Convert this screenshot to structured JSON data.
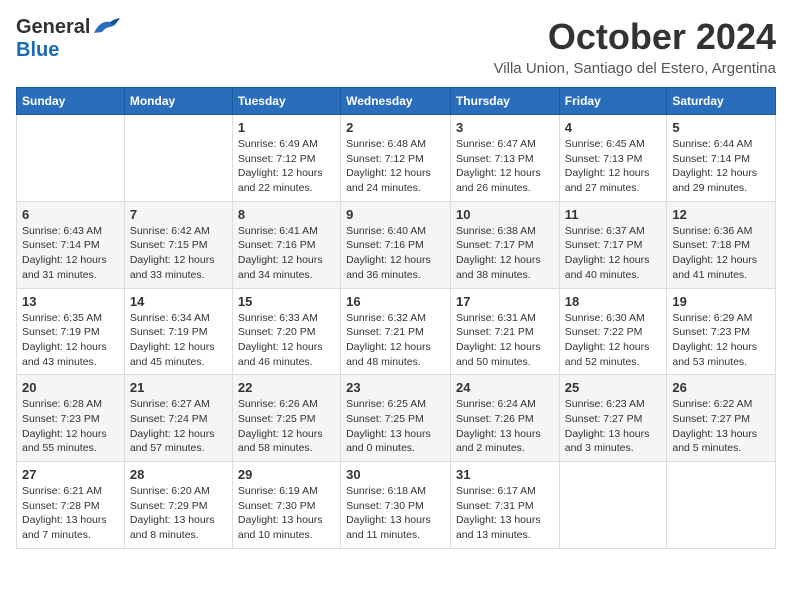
{
  "header": {
    "logo_general": "General",
    "logo_blue": "Blue",
    "month": "October 2024",
    "location": "Villa Union, Santiago del Estero, Argentina"
  },
  "weekdays": [
    "Sunday",
    "Monday",
    "Tuesday",
    "Wednesday",
    "Thursday",
    "Friday",
    "Saturday"
  ],
  "rows": [
    [
      {
        "day": "",
        "info": ""
      },
      {
        "day": "",
        "info": ""
      },
      {
        "day": "1",
        "info": "Sunrise: 6:49 AM\nSunset: 7:12 PM\nDaylight: 12 hours and 22 minutes."
      },
      {
        "day": "2",
        "info": "Sunrise: 6:48 AM\nSunset: 7:12 PM\nDaylight: 12 hours and 24 minutes."
      },
      {
        "day": "3",
        "info": "Sunrise: 6:47 AM\nSunset: 7:13 PM\nDaylight: 12 hours and 26 minutes."
      },
      {
        "day": "4",
        "info": "Sunrise: 6:45 AM\nSunset: 7:13 PM\nDaylight: 12 hours and 27 minutes."
      },
      {
        "day": "5",
        "info": "Sunrise: 6:44 AM\nSunset: 7:14 PM\nDaylight: 12 hours and 29 minutes."
      }
    ],
    [
      {
        "day": "6",
        "info": "Sunrise: 6:43 AM\nSunset: 7:14 PM\nDaylight: 12 hours and 31 minutes."
      },
      {
        "day": "7",
        "info": "Sunrise: 6:42 AM\nSunset: 7:15 PM\nDaylight: 12 hours and 33 minutes."
      },
      {
        "day": "8",
        "info": "Sunrise: 6:41 AM\nSunset: 7:16 PM\nDaylight: 12 hours and 34 minutes."
      },
      {
        "day": "9",
        "info": "Sunrise: 6:40 AM\nSunset: 7:16 PM\nDaylight: 12 hours and 36 minutes."
      },
      {
        "day": "10",
        "info": "Sunrise: 6:38 AM\nSunset: 7:17 PM\nDaylight: 12 hours and 38 minutes."
      },
      {
        "day": "11",
        "info": "Sunrise: 6:37 AM\nSunset: 7:17 PM\nDaylight: 12 hours and 40 minutes."
      },
      {
        "day": "12",
        "info": "Sunrise: 6:36 AM\nSunset: 7:18 PM\nDaylight: 12 hours and 41 minutes."
      }
    ],
    [
      {
        "day": "13",
        "info": "Sunrise: 6:35 AM\nSunset: 7:19 PM\nDaylight: 12 hours and 43 minutes."
      },
      {
        "day": "14",
        "info": "Sunrise: 6:34 AM\nSunset: 7:19 PM\nDaylight: 12 hours and 45 minutes."
      },
      {
        "day": "15",
        "info": "Sunrise: 6:33 AM\nSunset: 7:20 PM\nDaylight: 12 hours and 46 minutes."
      },
      {
        "day": "16",
        "info": "Sunrise: 6:32 AM\nSunset: 7:21 PM\nDaylight: 12 hours and 48 minutes."
      },
      {
        "day": "17",
        "info": "Sunrise: 6:31 AM\nSunset: 7:21 PM\nDaylight: 12 hours and 50 minutes."
      },
      {
        "day": "18",
        "info": "Sunrise: 6:30 AM\nSunset: 7:22 PM\nDaylight: 12 hours and 52 minutes."
      },
      {
        "day": "19",
        "info": "Sunrise: 6:29 AM\nSunset: 7:23 PM\nDaylight: 12 hours and 53 minutes."
      }
    ],
    [
      {
        "day": "20",
        "info": "Sunrise: 6:28 AM\nSunset: 7:23 PM\nDaylight: 12 hours and 55 minutes."
      },
      {
        "day": "21",
        "info": "Sunrise: 6:27 AM\nSunset: 7:24 PM\nDaylight: 12 hours and 57 minutes."
      },
      {
        "day": "22",
        "info": "Sunrise: 6:26 AM\nSunset: 7:25 PM\nDaylight: 12 hours and 58 minutes."
      },
      {
        "day": "23",
        "info": "Sunrise: 6:25 AM\nSunset: 7:25 PM\nDaylight: 13 hours and 0 minutes."
      },
      {
        "day": "24",
        "info": "Sunrise: 6:24 AM\nSunset: 7:26 PM\nDaylight: 13 hours and 2 minutes."
      },
      {
        "day": "25",
        "info": "Sunrise: 6:23 AM\nSunset: 7:27 PM\nDaylight: 13 hours and 3 minutes."
      },
      {
        "day": "26",
        "info": "Sunrise: 6:22 AM\nSunset: 7:27 PM\nDaylight: 13 hours and 5 minutes."
      }
    ],
    [
      {
        "day": "27",
        "info": "Sunrise: 6:21 AM\nSunset: 7:28 PM\nDaylight: 13 hours and 7 minutes."
      },
      {
        "day": "28",
        "info": "Sunrise: 6:20 AM\nSunset: 7:29 PM\nDaylight: 13 hours and 8 minutes."
      },
      {
        "day": "29",
        "info": "Sunrise: 6:19 AM\nSunset: 7:30 PM\nDaylight: 13 hours and 10 minutes."
      },
      {
        "day": "30",
        "info": "Sunrise: 6:18 AM\nSunset: 7:30 PM\nDaylight: 13 hours and 11 minutes."
      },
      {
        "day": "31",
        "info": "Sunrise: 6:17 AM\nSunset: 7:31 PM\nDaylight: 13 hours and 13 minutes."
      },
      {
        "day": "",
        "info": ""
      },
      {
        "day": "",
        "info": ""
      }
    ]
  ]
}
